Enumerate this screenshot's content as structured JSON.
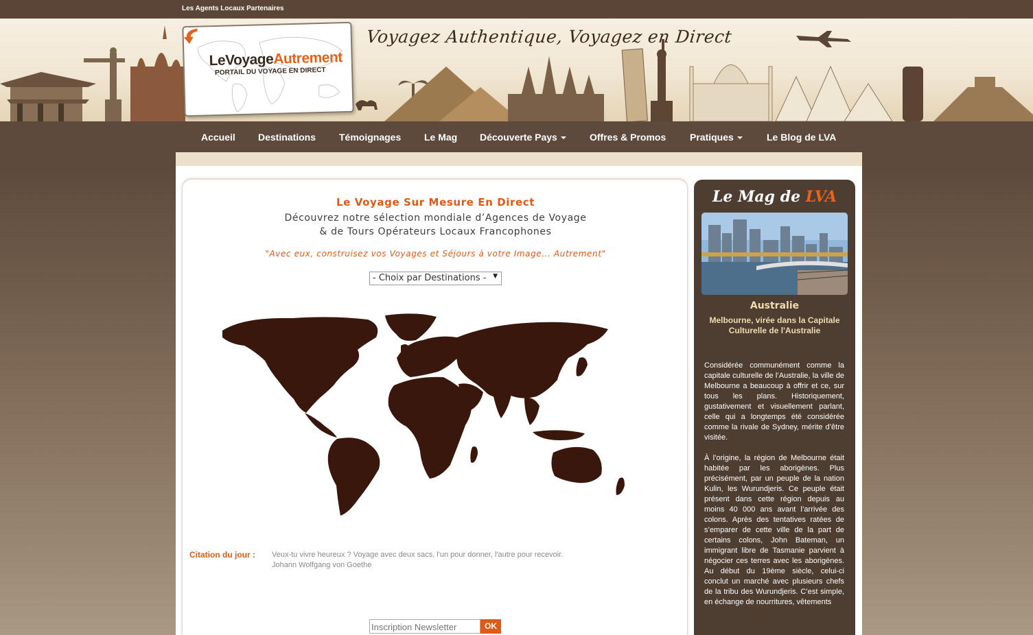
{
  "topbar": {
    "link": "Les Agents Locaux Partenaires"
  },
  "logo": {
    "part1": "LeVoyage",
    "part2": "Autrement",
    "subtitle": "PORTAIL DU VOYAGE EN DIRECT"
  },
  "slogan": "Voyagez Authentique, Voyagez en Direct",
  "nav": {
    "items": [
      {
        "label": "Accueil"
      },
      {
        "label": "Destinations"
      },
      {
        "label": "Témoignages"
      },
      {
        "label": "Le Mag"
      },
      {
        "label": "Découverte Pays",
        "dropdown": true
      },
      {
        "label": "Offres & Promos"
      },
      {
        "label": "Pratiques",
        "dropdown": true
      },
      {
        "label": "Le Blog de LVA"
      }
    ]
  },
  "main": {
    "title": "Le Voyage Sur Mesure En Direct",
    "line1": "Découvrez notre sélection mondiale d’Agences de Voyage",
    "line2": "& de Tours Opérateurs Locaux Francophones",
    "quote": "\"Avec eux, construisez vos Voyages et Séjours à votre Image... Autrement\"",
    "select_value": "- Choix par Destinations -",
    "citation_label": "Citation du jour :",
    "citation_text": "Veux-tu vivre heureux ? Voyage avec deux sacs, l'un pour donner, l'autre pour recevoir.",
    "citation_author": "Johann Wolfgang von Goethe",
    "newsletter_placeholder": "Inscription Newsletter",
    "ok_label": "OK"
  },
  "side": {
    "mag_prefix": "Le Mag de",
    "mag_brand": "LVA",
    "country": "Australie",
    "headline": "Melbourne, virée dans la Capitale Culturelle de l'Australie",
    "para1": "Considérée communément comme la capitale culturelle de l’Australie, la ville de Melbourne a beaucoup à offrir et ce, sur tous les plans. Historiquement, gustativement et visuellement parlant, celle qui a longtemps été considérée comme la rivale de Sydney, mérite d’être visitée.",
    "para2": "À l’origine, la région de Melbourne était habitée par les aborigènes. Plus précisément, par un peuple de la nation Kulin, les Wurundjeris. Ce peuple était présent dans cette région depuis au moins 40 000 ans avant l’arrivée des colons. Après des tentatives ratées de s’emparer de cette ville de la part de certains colons, John Bateman, un immigrant libre de Tasmanie parvient à négocier ces terres avec les aborigènes. Au début du 19ème siècle, celui-ci conclut un marché avec plusieurs chefs de la tribu des Wurundjeris. C’est simple, en échange de nourritures, vêtements"
  },
  "colors": {
    "accent": "#e05a16",
    "brown_dark": "#5e4a3c",
    "side_bg": "#4e3d31",
    "map_fill": "#3a170c"
  }
}
